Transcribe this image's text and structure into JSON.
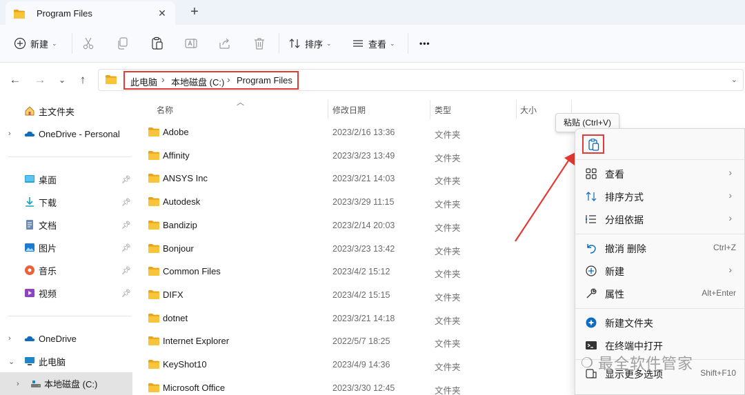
{
  "tab": {
    "title": "Program Files",
    "close": "✕",
    "new_tab": "+"
  },
  "toolbar": {
    "new_label": "新建",
    "sort_label": "排序",
    "view_label": "查看",
    "more_label": "•••",
    "icons": [
      "cut-icon",
      "copy-icon",
      "paste-icon",
      "rename-icon",
      "share-icon",
      "delete-icon"
    ]
  },
  "address": {
    "crumbs": [
      "此电脑",
      "本地磁盘 (C:)",
      "Program Files"
    ],
    "separator": "›"
  },
  "sidebar": {
    "home": "主文件夹",
    "onedrive_personal": "OneDrive - Personal",
    "quick": [
      {
        "label": "桌面",
        "icon": "desktop-icon"
      },
      {
        "label": "下载",
        "icon": "download-icon"
      },
      {
        "label": "文档",
        "icon": "documents-icon"
      },
      {
        "label": "图片",
        "icon": "pictures-icon"
      },
      {
        "label": "音乐",
        "icon": "music-icon"
      },
      {
        "label": "视频",
        "icon": "videos-icon"
      }
    ],
    "onedrive": "OneDrive",
    "this_pc": "此电脑",
    "local_disk": "本地磁盘 (C:)"
  },
  "columns": {
    "name": "名称",
    "modified": "修改日期",
    "type": "类型",
    "size": "大小"
  },
  "files": [
    {
      "name": "Adobe",
      "date": "2023/2/16 13:36",
      "type": "文件夹"
    },
    {
      "name": "Affinity",
      "date": "2023/3/23 13:49",
      "type": "文件夹"
    },
    {
      "name": "ANSYS Inc",
      "date": "2023/3/21 14:03",
      "type": "文件夹"
    },
    {
      "name": "Autodesk",
      "date": "2023/3/29 11:15",
      "type": "文件夹"
    },
    {
      "name": "Bandizip",
      "date": "2023/2/14 20:03",
      "type": "文件夹"
    },
    {
      "name": "Bonjour",
      "date": "2023/3/23 13:42",
      "type": "文件夹"
    },
    {
      "name": "Common Files",
      "date": "2023/4/2 15:12",
      "type": "文件夹"
    },
    {
      "name": "DIFX",
      "date": "2023/4/2 15:15",
      "type": "文件夹"
    },
    {
      "name": "dotnet",
      "date": "2023/3/21 14:18",
      "type": "文件夹"
    },
    {
      "name": "Internet Explorer",
      "date": "2022/5/7 18:25",
      "type": "文件夹"
    },
    {
      "name": "KeyShot10",
      "date": "2023/4/9 14:36",
      "type": "文件夹"
    },
    {
      "name": "Microsoft Office",
      "date": "2023/3/30 12:45",
      "type": "文件夹"
    }
  ],
  "context_menu": {
    "tooltip": "粘贴 (Ctrl+V)",
    "view": "查看",
    "sort_by": "排序方式",
    "group_by": "分组依据",
    "undo": "撤消 删除",
    "undo_shortcut": "Ctrl+Z",
    "new": "新建",
    "properties": "属性",
    "properties_shortcut": "Alt+Enter",
    "new_folder": "新建文件夹",
    "open_terminal": "在终端中打开",
    "more_options": "显示更多选项",
    "more_shortcut": "Shift+F10"
  },
  "watermark": "最全软件管家",
  "colors": {
    "accent": "#0067c0",
    "highlight": "#e53935",
    "folder": "#f8c43a"
  }
}
